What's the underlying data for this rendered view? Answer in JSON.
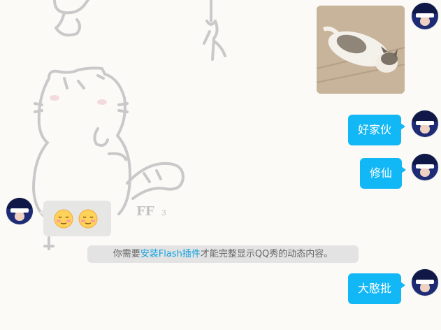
{
  "messages": {
    "bubble1": "好家伙",
    "bubble2": "修仙",
    "bubble3": "大憨批"
  },
  "notice": {
    "before": "你需要",
    "link": "安装Flash插件",
    "after": "才能完整显示QQ秀的动态内容。"
  },
  "background": {
    "label": "FF",
    "sub": "3"
  },
  "colors": {
    "accent": "#12b7f5",
    "link": "#12a2df",
    "background": "#fbfaf7"
  },
  "icons": {
    "emoji_1": "sleepy-face-emoji",
    "emoji_2": "sleepy-face-emoji",
    "photo": "cat-lying-on-floor"
  }
}
